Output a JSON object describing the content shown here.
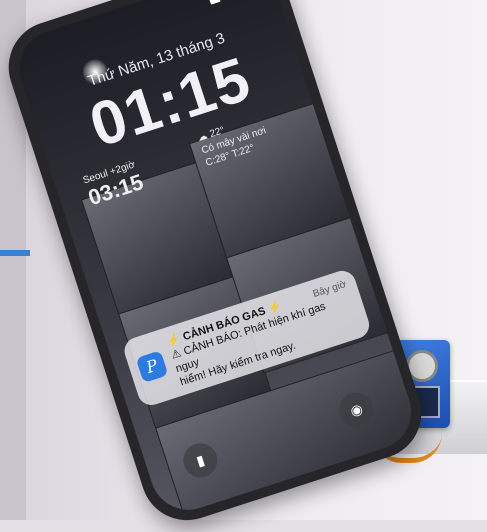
{
  "lockscreen": {
    "date": "Thứ Năm, 13 tháng 3",
    "time": "01:15",
    "widget_left": {
      "label": "Seoul +2giờ",
      "value": "03:15"
    },
    "widget_right": {
      "temp": "☁ 22°",
      "condition": "Có mây vài nơi",
      "range": "C:28° T:22°"
    }
  },
  "notification": {
    "app_icon_glyph": "P",
    "time_ago": "Bây giờ",
    "title": "⚡ CẢNH BÁO GAS ⚡",
    "body_line1": "⚠ CẢNH BÁO: Phát hiện khí gas nguy",
    "body_line2": "hiểm! Hãy kiểm tra ngay."
  },
  "icons": {
    "flashlight": "flashlight-icon",
    "camera": "camera-icon"
  }
}
